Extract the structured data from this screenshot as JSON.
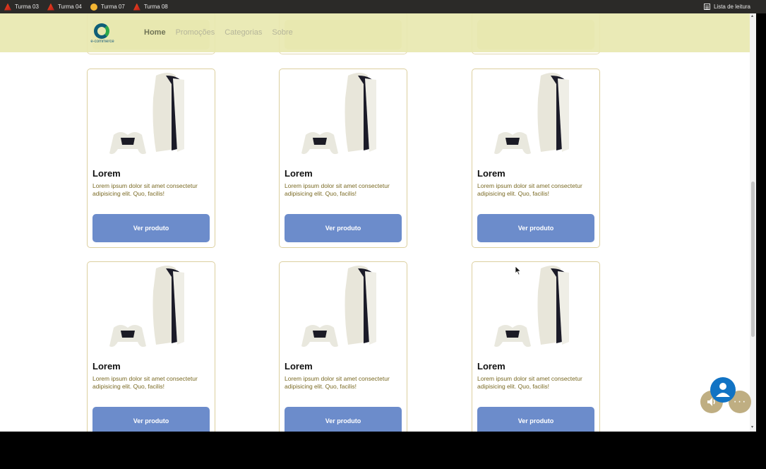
{
  "browser": {
    "bookmarks": [
      {
        "label": "Turma 03",
        "icon": "flame-icon"
      },
      {
        "label": "Turma 04",
        "icon": "flame-icon"
      },
      {
        "label": "Turma 07",
        "icon": "face-icon"
      },
      {
        "label": "Turma 08",
        "icon": "flame-icon"
      }
    ],
    "reading_list": "Lista de leitura"
  },
  "header": {
    "logo_text": "e-commerce",
    "nav": [
      {
        "label": "Home",
        "active": true
      },
      {
        "label": "Promoções",
        "active": false
      },
      {
        "label": "Categorias",
        "active": false
      },
      {
        "label": "Sobre",
        "active": false
      }
    ]
  },
  "products": [
    {
      "title": "Lorem",
      "description": "Lorem ipsum dolor sit amet consectetur adipisicing elit. Quo, facilis!",
      "button": "Ver produto"
    },
    {
      "title": "Lorem",
      "description": "Lorem ipsum dolor sit amet consectetur adipisicing elit. Quo, facilis!",
      "button": "Ver produto"
    },
    {
      "title": "Lorem",
      "description": "Lorem ipsum dolor sit amet consectetur adipisicing elit. Quo, facilis!",
      "button": "Ver produto"
    },
    {
      "title": "Lorem",
      "description": "Lorem ipsum dolor sit amet consectetur adipisicing elit. Quo, facilis!",
      "button": "Ver produto"
    },
    {
      "title": "Lorem",
      "description": "Lorem ipsum dolor sit amet consectetur adipisicing elit. Quo, facilis!",
      "button": "Ver produto"
    },
    {
      "title": "Lorem",
      "description": "Lorem ipsum dolor sit amet consectetur adipisicing elit. Quo, facilis!",
      "button": "Ver produto"
    }
  ],
  "colors": {
    "header_bg": "#e8e8b0",
    "button_bg": "#6c8ccb",
    "card_border": "#dccf9f",
    "description_text": "#7a6a24",
    "accessibility_user": "#1173c4",
    "floating_bg": "#bfae82"
  },
  "widgets": {
    "user_icon": "user-icon",
    "sound_icon": "speaker-icon",
    "more_icon": "more-icon"
  }
}
